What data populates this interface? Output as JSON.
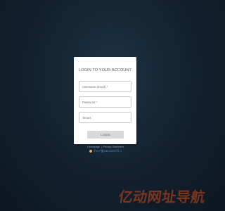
{
  "login": {
    "title": "LOGIN TO YOUR ACCOUNT",
    "username_placeholder": "Username (Email) *",
    "password_placeholder": "Password *",
    "tenant_placeholder": "Tenant",
    "button_label": "LOGIN"
  },
  "footer": {
    "links": [
      "Homepage",
      "Privacy Statement"
    ],
    "separator": "|",
    "icp_text": "沪ICP备18033095号-1",
    "icp_icon": "police-badge-icon"
  },
  "watermark": {
    "text": "亿动网址导航"
  },
  "colors": {
    "background": "#142331",
    "card": "#ffffff",
    "button": "#d9d9d9",
    "link": "#4a8fd8",
    "watermark": "#d04a17"
  }
}
